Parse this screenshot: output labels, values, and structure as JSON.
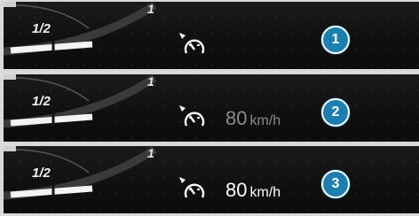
{
  "panels": [
    {
      "fraction": "1/2",
      "mark": "1",
      "speed_value": "",
      "speed_unit": "",
      "step": "1",
      "icon": "cruise-control-icon"
    },
    {
      "fraction": "1/2",
      "mark": "1",
      "speed_value": "80",
      "speed_unit": "km/h",
      "step": "2",
      "icon": "cruise-control-icon",
      "speed_state": "dimmed"
    },
    {
      "fraction": "1/2",
      "mark": "1",
      "speed_value": "80",
      "speed_unit": "km/h",
      "step": "3",
      "icon": "cruise-control-icon",
      "speed_state": "active"
    }
  ],
  "colors": {
    "panel_bg": "#121212",
    "badge": "#1d7fb0",
    "speed_dimmed": "#8a8a8a",
    "speed_active": "#ffffff"
  }
}
